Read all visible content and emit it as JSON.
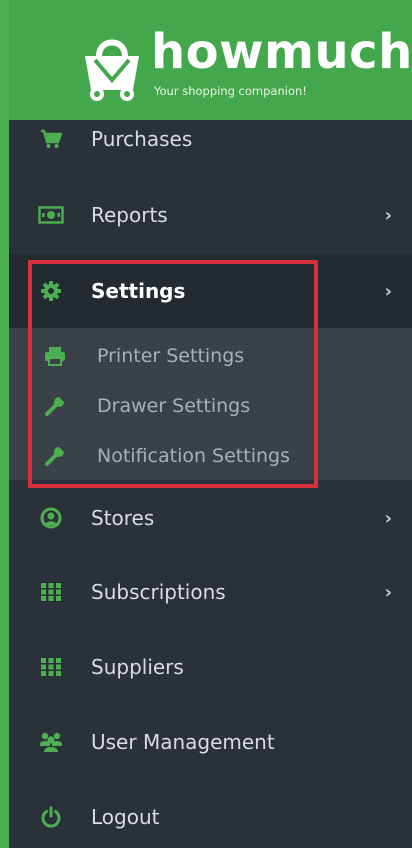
{
  "brand": {
    "name": "howmuch",
    "tagline": "Your shopping companion!",
    "color": "#43a84b",
    "logo_icon": "shopping-bag-icon"
  },
  "menu": {
    "items": [
      {
        "label": "Purchases",
        "icon": "cart-icon",
        "has_submenu": false
      },
      {
        "label": "Reports",
        "icon": "cash-icon",
        "has_submenu": true
      },
      {
        "label": "Settings",
        "icon": "gear-icon",
        "has_submenu": true,
        "active": true,
        "children": [
          {
            "label": "Printer Settings",
            "icon": "printer-icon"
          },
          {
            "label": "Drawer Settings",
            "icon": "wrench-icon"
          },
          {
            "label": "Notification Settings",
            "icon": "wrench-icon"
          }
        ]
      },
      {
        "label": "Stores",
        "icon": "user-circle-icon",
        "has_submenu": true
      },
      {
        "label": "Subscriptions",
        "icon": "grid-icon",
        "has_submenu": true
      },
      {
        "label": "Suppliers",
        "icon": "grid-icon",
        "has_submenu": false
      },
      {
        "label": "User Management",
        "icon": "users-icon",
        "has_submenu": false
      },
      {
        "label": "Logout",
        "icon": "power-icon",
        "has_submenu": false
      }
    ],
    "chevron": "›",
    "icon_color": "#4caf50",
    "highlight_color": "#d5303c"
  }
}
